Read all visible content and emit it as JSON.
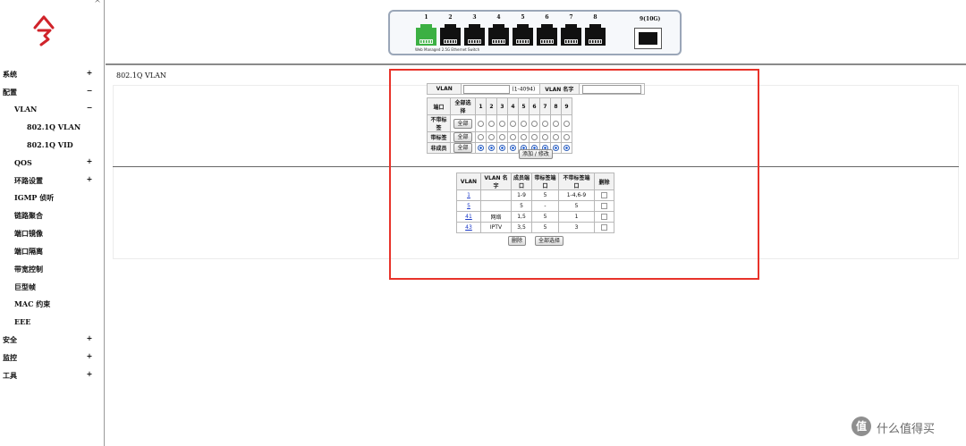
{
  "sidebar": {
    "scroll_up": "^",
    "logo_char": "今",
    "items": [
      {
        "label": "系统",
        "toggle": "+"
      },
      {
        "label": "配置",
        "toggle": "−"
      },
      {
        "label": "VLAN",
        "toggle": "−"
      },
      {
        "label": "802.1Q VLAN",
        "toggle": ""
      },
      {
        "label": "802.1Q VID",
        "toggle": ""
      },
      {
        "label": "QOS",
        "toggle": "+"
      },
      {
        "label": "环路设置",
        "toggle": "+"
      },
      {
        "label": "IGMP 侦听",
        "toggle": ""
      },
      {
        "label": "链路聚合",
        "toggle": ""
      },
      {
        "label": "端口镜像",
        "toggle": ""
      },
      {
        "label": "端口隔离",
        "toggle": ""
      },
      {
        "label": "带宽控制",
        "toggle": ""
      },
      {
        "label": "巨型帧",
        "toggle": ""
      },
      {
        "label": "MAC 约束",
        "toggle": ""
      },
      {
        "label": "EEE",
        "toggle": ""
      },
      {
        "label": "安全",
        "toggle": "+"
      },
      {
        "label": "监控",
        "toggle": "+"
      },
      {
        "label": "工具",
        "toggle": "+"
      }
    ]
  },
  "switch_panel": {
    "ports": [
      "1",
      "2",
      "3",
      "4",
      "5",
      "6",
      "7",
      "8"
    ],
    "active_port": "1",
    "sfp_label": "9(10G)",
    "caption": "Web Managed 2.5G Ethernet Switch",
    "colors": {
      "active": "#3cb043",
      "inactive": "#111111"
    }
  },
  "section_title": "802.1Q VLAN",
  "config": {
    "vlan_label": "VLAN",
    "vlan_value": "",
    "vlan_range": "(1-4094)",
    "vlan_name_label": "VLAN 名字",
    "vlan_name_value": "",
    "port_header": "端口",
    "select_all_header": "全部选择",
    "ports": [
      "1",
      "2",
      "3",
      "4",
      "5",
      "6",
      "7",
      "8",
      "9"
    ],
    "rows": [
      {
        "label": "不带标签",
        "button": "全部",
        "selected": [
          false,
          false,
          false,
          false,
          false,
          false,
          false,
          false,
          false
        ]
      },
      {
        "label": "带标签",
        "button": "全部",
        "selected": [
          false,
          false,
          false,
          false,
          false,
          false,
          false,
          false,
          false
        ]
      },
      {
        "label": "非成员",
        "button": "全部",
        "selected": [
          true,
          true,
          true,
          true,
          true,
          true,
          true,
          true,
          true
        ]
      }
    ],
    "add_button": "添加 / 修改"
  },
  "vlan_list": {
    "headers": [
      "VLAN",
      "VLAN 名字",
      "成员端口",
      "带标签端口",
      "不带标签端口",
      "删除"
    ],
    "rows": [
      {
        "vlan": "1",
        "name": "",
        "members": "1-9",
        "tagged": "5",
        "untagged": "1-4,6-9"
      },
      {
        "vlan": "5",
        "name": "",
        "members": "5",
        "tagged": "-",
        "untagged": "5"
      },
      {
        "vlan": "41",
        "name": "网络",
        "members": "1,5",
        "tagged": "5",
        "untagged": "1"
      },
      {
        "vlan": "43",
        "name": "IPTV",
        "members": "3,5",
        "tagged": "5",
        "untagged": "3"
      }
    ],
    "delete_button": "删除",
    "select_all_button": "全部选择"
  },
  "highlight_color": "#e8332a",
  "watermark": {
    "icon": "值",
    "text": "什么值得买"
  }
}
